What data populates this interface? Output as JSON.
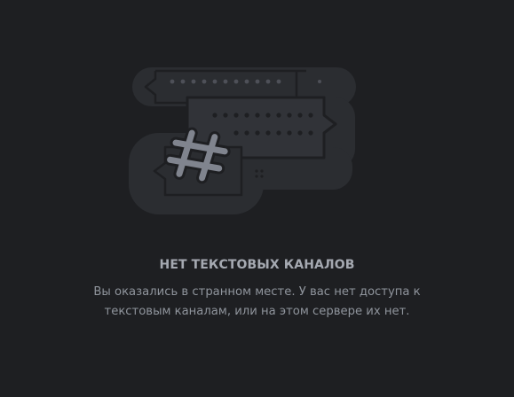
{
  "empty_state": {
    "title": "НЕТ ТЕКСТОВЫХ КАНАЛОВ",
    "description": "Вы оказались в странном месте. У вас нет доступа к текстовым каналам, или на этом сервере их нет.",
    "illustration_icon": "hash-icon"
  },
  "colors": {
    "background": "#1e1f22",
    "title": "#a5a9b1",
    "description": "#8f949c",
    "bubble": "#2b2d31",
    "bubble_outline": "#1e1f22",
    "dot": "#4e5058",
    "hash": "#80848e"
  }
}
